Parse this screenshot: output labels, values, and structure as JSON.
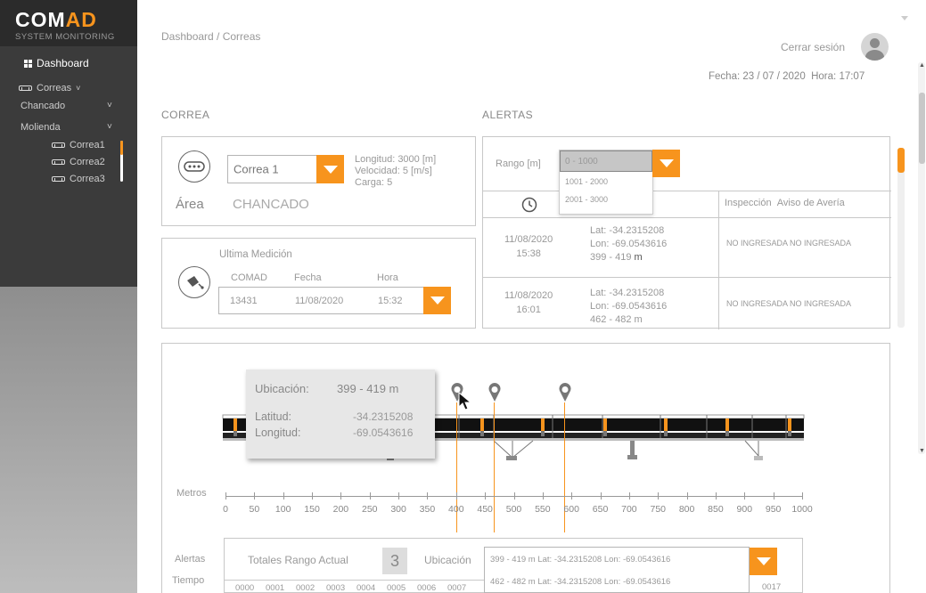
{
  "sidebar": {
    "brand_main": "COM",
    "brand_accent": "AD",
    "brand_sub": "SYSTEM MONITORING",
    "dashboard": "Dashboard",
    "correas": "Correas",
    "chancado": "Chancado",
    "molienda": "Molienda",
    "items": [
      "Correa1",
      "Correa2",
      "Correa3"
    ]
  },
  "header": {
    "breadcrumb": "Dashboard / Correas",
    "logout": "Cerrar sesión",
    "date_label": "Fecha:",
    "date": "23 / 07 / 2020",
    "time_label": "Hora:",
    "time": "17:07"
  },
  "correa": {
    "title": "CORREA",
    "selected": "Correa 1",
    "info": [
      "Longitud: 3000 [m]",
      "Velocidad: 5 [m/s]",
      "Carga: 5"
    ],
    "area_label": "Área",
    "area_value": "CHANCADO"
  },
  "medicion": {
    "title": "Ultima Medición",
    "headers": [
      "COMAD",
      "Fecha",
      "Hora"
    ],
    "values": [
      "13431",
      "11/08/2020",
      "15:32"
    ]
  },
  "alertas": {
    "title": "ALERTAS",
    "rango_label": "Rango [m]",
    "rango_selected": "0 - 1000",
    "rango_options": [
      "1001 - 2000",
      "2001 - 3000"
    ],
    "col_inspeccion": "Inspección",
    "col_aviso": "Aviso de Avería",
    "rows": [
      {
        "date": "11/08/2020",
        "time": "15:38",
        "lat": "Lat: -34.2315208",
        "lon": "Lon: -69.0543616",
        "range": "399 - 419",
        "unit": "m",
        "right": "NO INGRESADA   NO INGRESADA"
      },
      {
        "date": "11/08/2020",
        "time": "16:01",
        "lat": "Lat: -34.2315208",
        "lon": "Lon: -69.0543616",
        "range": "462 - 482",
        "unit": "m",
        "right": "NO INGRESADA   NO INGRESADA"
      }
    ]
  },
  "tooltip": {
    "ubicacion_label": "Ubicación:",
    "ubicacion_value": "399 - 419 m",
    "lat_label": "Latitud:",
    "lat_value": "-34.2315208",
    "lon_label": "Longitud:",
    "lon_value": "-69.0543616"
  },
  "axis": {
    "label": "Metros",
    "ticks": [
      "0",
      "50",
      "100",
      "150",
      "200",
      "250",
      "300",
      "350",
      "400",
      "450",
      "500",
      "550",
      "600",
      "650",
      "700",
      "750",
      "800",
      "850",
      "900",
      "950",
      "1000"
    ]
  },
  "bottom": {
    "alertas_label": "Alertas",
    "tiempo_label": "Tiempo",
    "totales_label": "Totales Rango Actual",
    "totales_value": "3",
    "ubicacion_label": "Ubicación",
    "ub_row1": "399 - 419 m     Lat: -34.2315208     Lon: -69.0543616",
    "ub_row2": "462 - 482 m     Lat: -34.2315208     Lon: -69.0543616",
    "times": [
      "0000",
      "0001",
      "0002",
      "0003",
      "0004",
      "0005",
      "0006",
      "0007"
    ],
    "last_time": "0017"
  },
  "colors": {
    "accent": "#f7941d",
    "sidebar": "#3b3b3b"
  }
}
